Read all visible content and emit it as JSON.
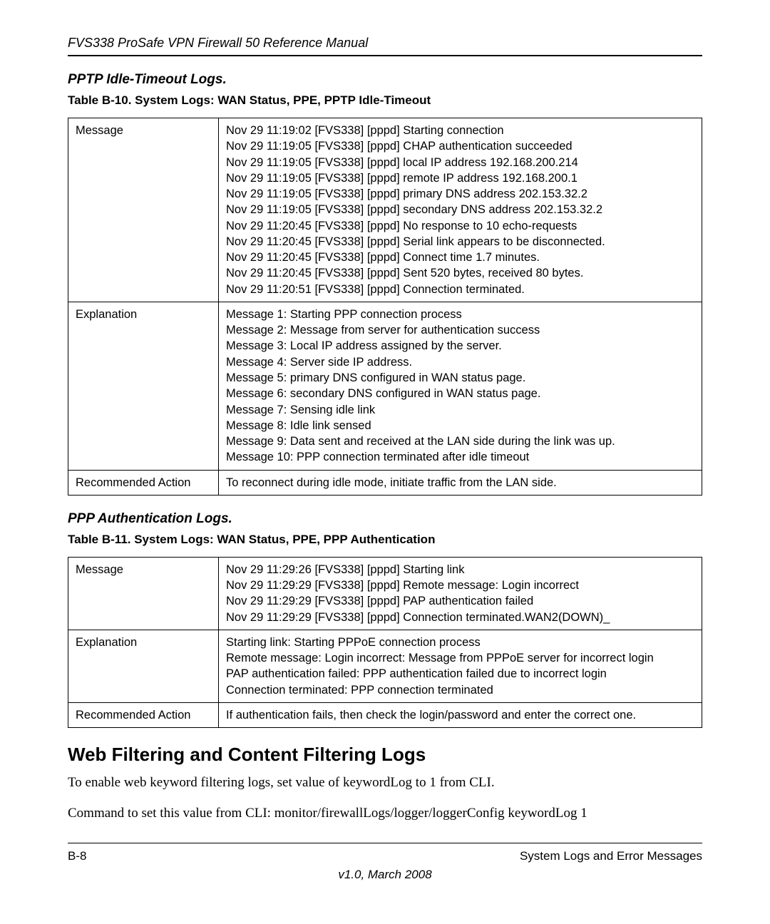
{
  "running_header": "FVS338 ProSafe VPN Firewall 50 Reference Manual",
  "section1": {
    "subheading": "PPTP Idle-Timeout Logs.",
    "table_caption": "Table B-10. System Logs: WAN Status, PPE, PPTP Idle-Timeout",
    "rows": [
      {
        "label": "Message",
        "value": "Nov 29 11:19:02 [FVS338] [pppd] Starting connection\nNov 29 11:19:05 [FVS338] [pppd] CHAP authentication succeeded\nNov 29 11:19:05 [FVS338] [pppd] local IP address 192.168.200.214\nNov 29 11:19:05 [FVS338] [pppd] remote IP address 192.168.200.1\nNov 29 11:19:05 [FVS338] [pppd] primary DNS address 202.153.32.2\nNov 29 11:19:05 [FVS338] [pppd] secondary DNS address 202.153.32.2\nNov 29 11:20:45 [FVS338] [pppd] No response to 10 echo-requests\nNov 29 11:20:45 [FVS338] [pppd] Serial link appears to be disconnected.\nNov 29 11:20:45 [FVS338] [pppd] Connect time 1.7 minutes.\nNov 29 11:20:45 [FVS338] [pppd] Sent 520 bytes, received 80 bytes.\nNov 29 11:20:51 [FVS338] [pppd] Connection terminated."
      },
      {
        "label": "Explanation",
        "value": "Message 1: Starting PPP connection process\nMessage 2: Message from server for authentication success\nMessage 3: Local IP address assigned by the server.\nMessage 4: Server side IP address.\nMessage 5: primary DNS configured in WAN status page.\nMessage 6: secondary DNS configured in WAN status page.\nMessage 7: Sensing idle link\nMessage 8: Idle link sensed\nMessage 9: Data sent and received at the LAN side during the link was up.\nMessage 10: PPP connection terminated after idle timeout"
      },
      {
        "label": "Recommended Action",
        "value": "To reconnect during idle mode, initiate traffic from the LAN side."
      }
    ]
  },
  "section2": {
    "subheading": "PPP Authentication Logs.",
    "table_caption": "Table B-11. System Logs: WAN Status, PPE, PPP Authentication",
    "rows": [
      {
        "label": "Message",
        "value": "Nov 29 11:29:26 [FVS338] [pppd] Starting link\nNov 29 11:29:29 [FVS338] [pppd] Remote message: Login incorrect\nNov 29 11:29:29 [FVS338] [pppd] PAP authentication failed\nNov 29 11:29:29 [FVS338] [pppd] Connection terminated.WAN2(DOWN)_"
      },
      {
        "label": "Explanation",
        "value": "Starting link: Starting PPPoE connection process\nRemote message: Login incorrect: Message from PPPoE server for incorrect login\nPAP authentication failed: PPP authentication failed due to incorrect login\nConnection terminated: PPP connection terminated"
      },
      {
        "label": "Recommended Action",
        "value": "If authentication fails, then check the login/password and enter the correct one."
      }
    ]
  },
  "heading_h2": "Web Filtering and Content Filtering Logs",
  "body_paragraphs": [
    "To enable web keyword filtering logs, set value of keywordLog to 1 from CLI.",
    "Command to set this value from CLI: monitor/firewallLogs/logger/loggerConfig keywordLog 1"
  ],
  "footer": {
    "page_number": "B-8",
    "section_title": "System Logs and Error Messages",
    "version": "v1.0, March 2008"
  }
}
